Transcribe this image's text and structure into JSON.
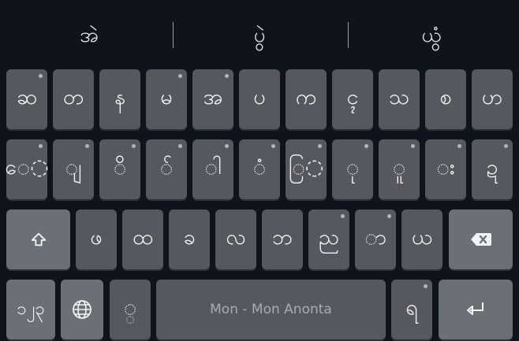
{
  "suggestions": [
    "အဲ",
    "ပွဲ",
    "ယွံ"
  ],
  "rows": [
    {
      "keys": [
        {
          "label": "ဆ",
          "hint": true
        },
        {
          "label": "တ",
          "hint": false
        },
        {
          "label": "န",
          "hint": false
        },
        {
          "label": "မ",
          "hint": true
        },
        {
          "label": "အ",
          "hint": true
        },
        {
          "label": "ပ",
          "hint": false
        },
        {
          "label": "က",
          "hint": false
        },
        {
          "label": "ၚ",
          "hint": false
        },
        {
          "label": "သ",
          "hint": false
        },
        {
          "label": "စ",
          "hint": false
        },
        {
          "label": "ဟ",
          "hint": false
        }
      ]
    },
    {
      "keys": [
        {
          "label": "ေ◌",
          "hint": true
        },
        {
          "label": "◌ျ",
          "hint": true
        },
        {
          "label": "◌ိ",
          "hint": true
        },
        {
          "label": "◌် ",
          "hint": true
        },
        {
          "label": "◌ါ",
          "hint": true
        },
        {
          "label": "◌ံ",
          "hint": true
        },
        {
          "label": "ြ◌",
          "hint": true
        },
        {
          "label": "◌ု",
          "hint": true
        },
        {
          "label": "◌ူ",
          "hint": true
        },
        {
          "label": "◌း",
          "hint": true
        },
        {
          "label": "ဍ",
          "hint": true
        }
      ]
    },
    {
      "keys": [
        {
          "label": "ဖ",
          "hint": false
        },
        {
          "label": "ထ",
          "hint": false
        },
        {
          "label": "ခ",
          "hint": false
        },
        {
          "label": "လ",
          "hint": false
        },
        {
          "label": "ဘ",
          "hint": false
        },
        {
          "label": "ည",
          "hint": true
        },
        {
          "label": "◌ာ",
          "hint": true
        },
        {
          "label": "ယ",
          "hint": false
        }
      ]
    }
  ],
  "bottom": {
    "numbers_label": "၁၂၃",
    "globe_icon": "globe-icon",
    "mark_label": "◌္",
    "space_label": "Mon - Mon Anonta",
    "last_label": "ရ"
  },
  "icons": {
    "shift": "shift-arrow-icon",
    "backspace": "backspace-icon",
    "enter": "enter-arrow-icon"
  },
  "colors": {
    "background": "#0f131c",
    "key": "#55585e",
    "function_key": "#6b6f76",
    "text": "#f2f3f5"
  }
}
